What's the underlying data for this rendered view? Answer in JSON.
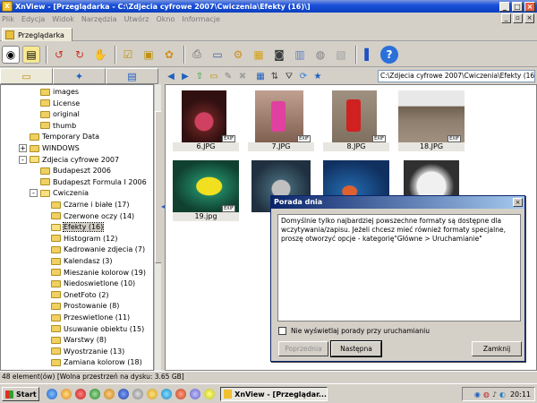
{
  "window": {
    "title": "XnView - [Przeglądarka - C:\\Zdjecia cyfrowe 2007\\Cwiczenia\\Efekty (16)\\]",
    "minimize": "_",
    "maximize": "□",
    "close": "×"
  },
  "menu": {
    "items": [
      "Plik",
      "Edycja",
      "Widok",
      "Narzędzia",
      "Utwórz",
      "Okno",
      "Informacje"
    ]
  },
  "tabs": [
    {
      "label": "Przeglądarka"
    }
  ],
  "toolbar": {
    "icons": [
      "view-icon",
      "folder-icon",
      "rotate-left-icon",
      "rotate-right-icon",
      "hand-icon",
      "checklist-icon",
      "select-icon",
      "settings-icon",
      "print-icon",
      "scan-icon",
      "batch-icon",
      "slideshow-icon",
      "camera-icon",
      "compare-icon",
      "web-icon",
      "convert-icon",
      "panel-icon",
      "help-icon"
    ]
  },
  "tree": {
    "items": [
      {
        "label": "images",
        "indent": 2,
        "open": false
      },
      {
        "label": "License",
        "indent": 2,
        "open": false
      },
      {
        "label": "original",
        "indent": 2,
        "open": false
      },
      {
        "label": "thumb",
        "indent": 2,
        "open": false
      },
      {
        "label": "Temporary Data",
        "indent": 1,
        "open": false
      },
      {
        "label": "WINDOWS",
        "indent": 1,
        "open": false,
        "expander": "+"
      },
      {
        "label": "Zdjecia cyfrowe 2007",
        "indent": 1,
        "open": true,
        "expander": "-"
      },
      {
        "label": "Budapeszt 2006",
        "indent": 2,
        "open": false
      },
      {
        "label": "Budapeszt Formula I 2006",
        "indent": 2,
        "open": false
      },
      {
        "label": "Cwiczenia",
        "indent": 2,
        "open": true,
        "expander": "-"
      },
      {
        "label": "Czarne i białe (17)",
        "indent": 3,
        "open": false
      },
      {
        "label": "Czerwone oczy (14)",
        "indent": 3,
        "open": false
      },
      {
        "label": "Efekty (16)",
        "indent": 3,
        "open": true,
        "selected": true
      },
      {
        "label": "Histogram (12)",
        "indent": 3,
        "open": false
      },
      {
        "label": "Kadrowanie zdjecia (7)",
        "indent": 3,
        "open": false
      },
      {
        "label": "Kalendasz (3)",
        "indent": 3,
        "open": false
      },
      {
        "label": "Mieszanie kolorow (19)",
        "indent": 3,
        "open": false
      },
      {
        "label": "Niedoswietlone (10)",
        "indent": 3,
        "open": false
      },
      {
        "label": "OnetFoto (2)",
        "indent": 3,
        "open": false
      },
      {
        "label": "Prostowanie (8)",
        "indent": 3,
        "open": false
      },
      {
        "label": "Przeswietlone (11)",
        "indent": 3,
        "open": false
      },
      {
        "label": "Usuwanie obiektu (15)",
        "indent": 3,
        "open": false
      },
      {
        "label": "Warstwy (8)",
        "indent": 3,
        "open": false
      },
      {
        "label": "Wyostrzanie (13)",
        "indent": 3,
        "open": false
      },
      {
        "label": "Zamiana kolorow (18)",
        "indent": 3,
        "open": false
      }
    ]
  },
  "nav": {
    "path": "C:\\Zdjecia cyfrowe 2007\\Cwiczenia\\Efekty (16)"
  },
  "thumbnails": [
    {
      "label": "6.JPG",
      "exif": "EXIF"
    },
    {
      "label": "7.JPG",
      "exif": "EXIF"
    },
    {
      "label": "8.JPG",
      "exif": "EXIF"
    },
    {
      "label": "18.JPG",
      "exif": "EXIF"
    },
    {
      "label": "19.jpg",
      "exif": "EXIF"
    },
    {
      "label": "",
      "exif": ""
    },
    {
      "label": "",
      "exif": ""
    },
    {
      "label": "",
      "exif": ""
    }
  ],
  "dialog": {
    "title": "Porada dnia",
    "close": "×",
    "text": "Domyślnie tylko najbardziej powszechne formaty są dostępne dla wczytywania/zapisu. Jeżeli chcesz mieć również formaty specjalne, proszę otworzyć opcje - kategorię\"Główne > Uruchamianie\"",
    "checkbox_label": "Nie wyświetlaj porady przy uruchamianiu",
    "prev_label": "Poprzednia",
    "next_label": "Następna",
    "close_label": "Zamknij"
  },
  "status": {
    "text": "48 element(ów) [Wolna przestrzeń na dysku: 3.65 GB]"
  },
  "taskbar": {
    "start_label": "Start",
    "task_label": "XnView - [Przeglądar...",
    "clock": "20:11"
  },
  "colors": {
    "title_blue": "#0a3fc0",
    "dialog_title": "#0a246a",
    "folder_yellow": "#f0d060"
  }
}
